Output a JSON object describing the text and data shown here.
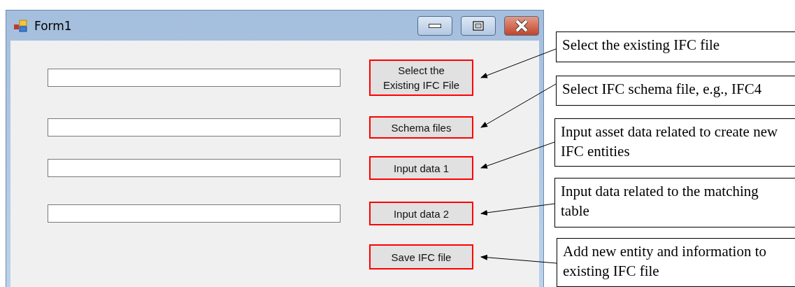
{
  "window": {
    "title": "Form1"
  },
  "rows": [
    {
      "button": "Select the Existing IFC File",
      "highlighted": true,
      "has_field": true
    },
    {
      "button": "Schema files",
      "highlighted": true,
      "has_field": true
    },
    {
      "button": "Input data 1",
      "highlighted": true,
      "has_field": true
    },
    {
      "button": "Input data 2",
      "highlighted": true,
      "has_field": true
    },
    {
      "button": "Save IFC file",
      "highlighted": true,
      "has_field": false
    }
  ],
  "callouts": [
    {
      "text": "Select the existing IFC file"
    },
    {
      "text": "Select IFC schema file, e.g., IFC4"
    },
    {
      "text": "Input asset data related to create new IFC entities"
    },
    {
      "text": "Input data related to the matching table"
    },
    {
      "text": "Add new entity and information to existing IFC file"
    }
  ]
}
